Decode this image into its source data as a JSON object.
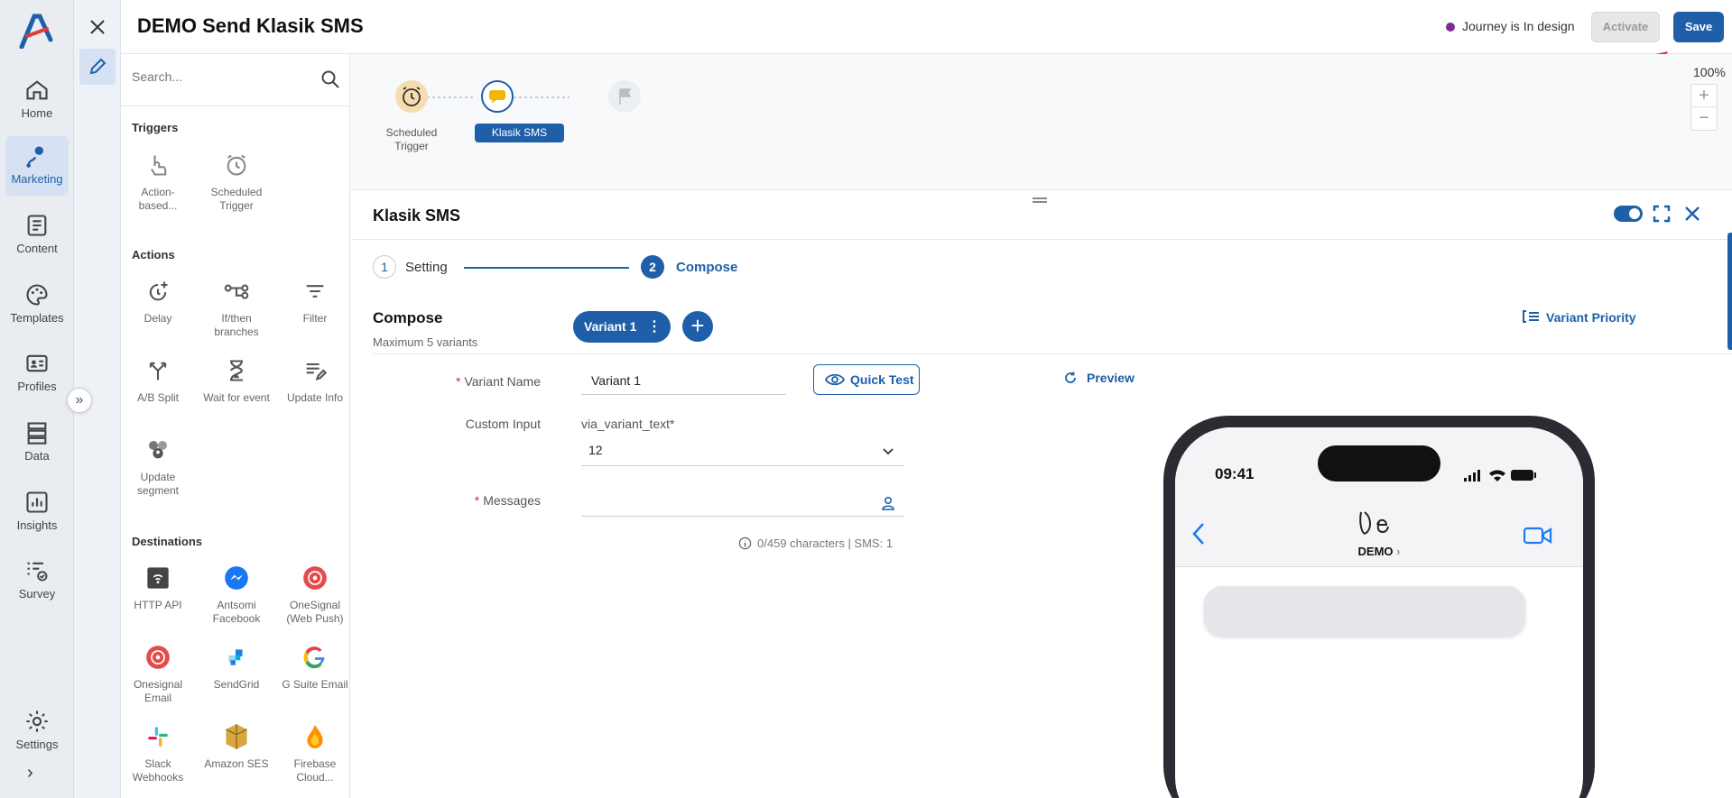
{
  "nav": {
    "items": [
      {
        "label": "Home"
      },
      {
        "label": "Marketing"
      },
      {
        "label": "Content"
      },
      {
        "label": "Templates"
      },
      {
        "label": "Profiles"
      },
      {
        "label": "Data"
      },
      {
        "label": "Insights"
      },
      {
        "label": "Survey"
      },
      {
        "label": "Settings"
      }
    ],
    "active": "Marketing"
  },
  "header": {
    "title": "DEMO Send Klasik SMS",
    "status": "Journey is In design",
    "status_color": "#7a2e8e",
    "activate_label": "Activate",
    "save_label": "Save"
  },
  "toolbox": {
    "search_placeholder": "Search...",
    "triggers_title": "Triggers",
    "triggers": [
      {
        "label": "Action-based...",
        "icon": "hand-pointer-icon"
      },
      {
        "label": "Scheduled Trigger",
        "icon": "alarm-clock-icon"
      }
    ],
    "actions_title": "Actions",
    "actions": [
      {
        "label": "Delay",
        "icon": "delay-icon"
      },
      {
        "label": "If/then branches",
        "icon": "branch-icon"
      },
      {
        "label": "Filter",
        "icon": "filter-icon"
      },
      {
        "label": "A/B Split",
        "icon": "split-icon"
      },
      {
        "label": "Wait for event",
        "icon": "hourglass-icon"
      },
      {
        "label": "Update Info",
        "icon": "update-info-icon"
      },
      {
        "label": "Update segment",
        "icon": "segment-icon"
      }
    ],
    "destinations_title": "Destinations",
    "destinations": [
      {
        "label": "HTTP API",
        "icon": "http-api-icon"
      },
      {
        "label": "Antsomi Facebook",
        "icon": "messenger-icon"
      },
      {
        "label": "OneSignal (Web Push)",
        "icon": "onesignal-icon"
      },
      {
        "label": "Onesignal Email",
        "icon": "onesignal-email-icon"
      },
      {
        "label": "SendGrid",
        "icon": "sendgrid-icon"
      },
      {
        "label": "G Suite Email",
        "icon": "google-icon"
      },
      {
        "label": "Slack Webhooks",
        "icon": "slack-icon"
      },
      {
        "label": "Amazon SES",
        "icon": "amazon-ses-icon"
      },
      {
        "label": "Firebase Cloud...",
        "icon": "firebase-icon"
      }
    ]
  },
  "canvas": {
    "zoom": "100%",
    "nodes": [
      {
        "label": "Scheduled Trigger"
      },
      {
        "label": "Klasik SMS"
      }
    ]
  },
  "detail": {
    "title": "Klasik SMS",
    "steps": [
      {
        "num": "1",
        "label": "Setting"
      },
      {
        "num": "2",
        "label": "Compose"
      }
    ],
    "compose_title": "Compose",
    "compose_sub": "Maximum 5 variants",
    "variant_label": "Variant 1",
    "variant_priority": "Variant Priority",
    "fields": {
      "variant_name_label": "Variant Name",
      "variant_name_value": "Variant 1",
      "quick_test": "Quick Test",
      "preview": "Preview",
      "custom_input_label": "Custom Input",
      "custom_input_key": "via_variant_text*",
      "custom_input_value": "12",
      "messages_label": "Messages",
      "char_count": "0/459 characters | SMS: 1"
    }
  },
  "phone": {
    "time": "09:41",
    "contact": "DEMO",
    "contact_suffix": "›"
  },
  "colors": {
    "primary": "#1f5fa9",
    "required": "#d32f2f"
  }
}
